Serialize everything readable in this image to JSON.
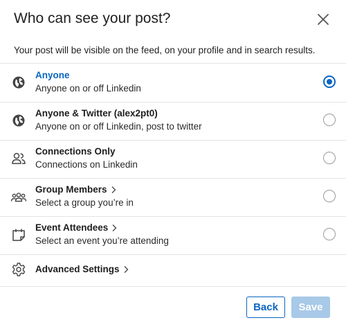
{
  "header": {
    "title": "Who can see your post?",
    "close_icon": "close-icon"
  },
  "subtitle": "Your post will be visible on the feed, on your profile and in search results.",
  "options": [
    {
      "title": "Anyone",
      "description": "Anyone on or off Linkedin",
      "icon": "globe-icon",
      "selected": true
    },
    {
      "title": "Anyone & Twitter (alex2pt0)",
      "description": "Anyone on or off Linkedin, post to twitter",
      "icon": "globe-icon",
      "selected": false
    },
    {
      "title": "Connections Only",
      "description": "Connections on Linkedin",
      "icon": "people-icon",
      "selected": false
    },
    {
      "title": "Group Members",
      "description": "Select a group you’re in",
      "icon": "group-icon",
      "selected": false,
      "has_submenu": true
    },
    {
      "title": "Event Attendees",
      "description": "Select an event you’re attending",
      "icon": "calendar-icon",
      "selected": false,
      "has_submenu": true
    }
  ],
  "advanced": {
    "title": "Advanced Settings",
    "icon": "gear-icon",
    "has_submenu": true
  },
  "footer": {
    "back_label": "Back",
    "save_label": "Save",
    "save_disabled": true
  },
  "colors": {
    "accent": "#0a66c2",
    "disabled_button": "#a8c9e8",
    "divider": "#e3e3e3"
  }
}
